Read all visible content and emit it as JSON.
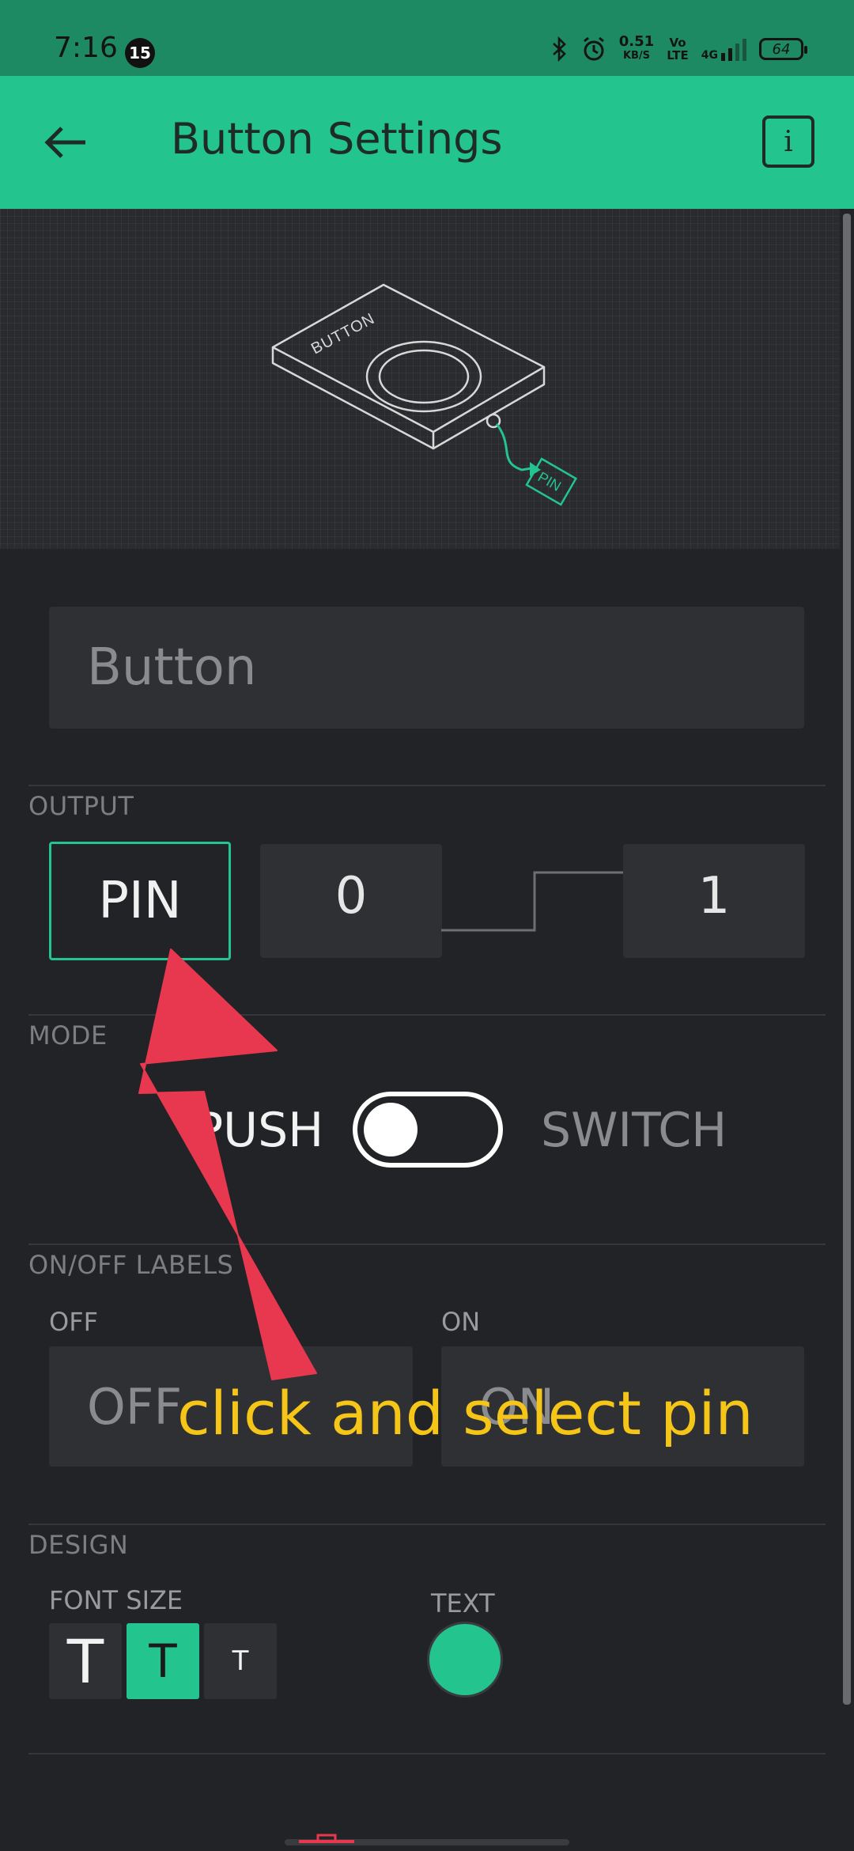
{
  "status_bar": {
    "time": "7:16",
    "notification_count": "15",
    "net_speed": "0.51",
    "net_unit": "KB/S",
    "volte_line1": "Vo",
    "volte_line2": "LTE",
    "network": "4G",
    "battery": "64",
    "icons": [
      "bluetooth-icon",
      "alarm-icon"
    ]
  },
  "app_bar": {
    "title": "Button Settings",
    "back_icon": "arrow-left-icon",
    "info_label": "i"
  },
  "illustration": {
    "device_label": "BUTTON",
    "pin_label": "PIN"
  },
  "name_field": {
    "value": "Button"
  },
  "output": {
    "section_label": "OUTPUT",
    "pin_label": "PIN",
    "low_value": "0",
    "high_value": "1"
  },
  "mode": {
    "section_label": "MODE",
    "option_push": "PUSH",
    "option_switch": "SWITCH",
    "selected": "PUSH"
  },
  "labels": {
    "section_label": "ON/OFF LABELS",
    "off_caption": "OFF",
    "on_caption": "ON",
    "off_value": "OFF",
    "on_value": "ON"
  },
  "design": {
    "section_label": "DESIGN",
    "font_size_label": "FONT SIZE",
    "font_options": [
      "T",
      "T",
      "T"
    ],
    "selected_font_index": 1,
    "text_color_label": "TEXT",
    "text_color": "#23c48e"
  },
  "annotation": {
    "text": "click and select pin",
    "arrow_color": "#e8384f",
    "text_color": "#f5c518"
  },
  "colors": {
    "accent": "#23c48e",
    "status_bar": "#1e8a63",
    "background": "#222326",
    "field": "#2f3033"
  }
}
